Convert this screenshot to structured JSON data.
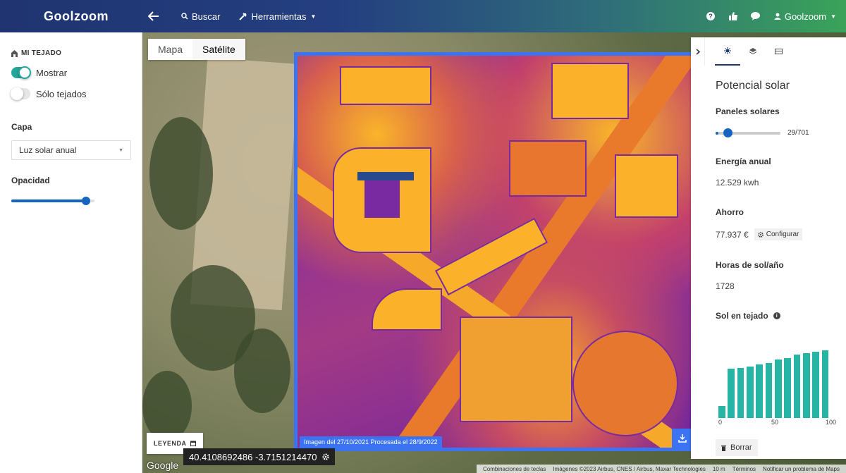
{
  "app": {
    "brand": "Goolzoom"
  },
  "topnav": {
    "back_icon": "arrow-left-icon",
    "search_label": "Buscar",
    "tools_label": "Herramientas",
    "user_label": "Goolzoom"
  },
  "sidebar": {
    "section_title": "MI TEJADO",
    "show_label": "Mostrar",
    "show_on": true,
    "roofs_only_label": "Sólo tejados",
    "roofs_only_on": false,
    "layer_label": "Capa",
    "layer_value": "Luz solar anual",
    "opacity_label": "Opacidad",
    "opacity_value": 0.9
  },
  "map": {
    "tabs": [
      {
        "label": "Mapa",
        "active": false
      },
      {
        "label": "Satélite",
        "active": true
      }
    ],
    "image_caption": "Imagen del 27/10/2021 Procesada el 28/9/2022",
    "legend_label": "LEYENDA",
    "coordinates": "40.4108692486 -3.7151214470",
    "google_logo": "Google",
    "attribution": {
      "shortcuts": "Combinaciones de teclas",
      "imagery": "Imágenes ©2023 Airbus, CNES / Airbus, Maxar Technologies",
      "scale": "10 m",
      "terms": "Términos",
      "report": "Notificar un problema de Maps"
    }
  },
  "panel": {
    "title": "Potencial solar",
    "panels_label": "Paneles solares",
    "panels_count": "29/701",
    "panels_fraction": 0.041,
    "energy_label": "Energía anual",
    "energy_value": "12.529 kwh",
    "savings_label": "Ahorro",
    "savings_value": "77.937 €",
    "configure_label": "Configurar",
    "hours_label": "Horas de sol/año",
    "hours_value": "1728",
    "sun_label": "Sol en tejado",
    "delete_label": "Borrar"
  },
  "chart_data": {
    "type": "bar",
    "title": "Sol en tejado",
    "values": [
      14,
      59,
      60,
      62,
      64,
      66,
      70,
      72,
      76,
      78,
      80,
      81
    ],
    "xlim": [
      0,
      100
    ],
    "xticks": [
      "0",
      "50",
      "100"
    ],
    "ylim": [
      0,
      100
    ],
    "color": "#26b5a5"
  }
}
